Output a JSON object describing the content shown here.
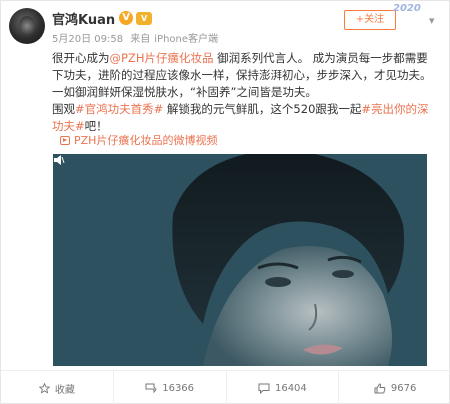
{
  "post": {
    "username": "官鸿Kuan",
    "verified_badge": "V",
    "level_badge": "V",
    "date": "5月20日 09:58",
    "source_prefix": "来自",
    "source": "iPhone客户端",
    "follow_label": "+关注",
    "anniversary_mark": "2020",
    "text": {
      "p1_a": "很开心成为",
      "p1_brand": "@PZH片仔癀化妆品",
      "p1_b": " 御润系列代言人。 成为演员每一步都需要下功夫，进阶的过程应该像水一样，保持澎湃初心，步步深入，才见功夫。一如御润鲜妍保湿悦肤水，“补固养”之间皆是功夫。",
      "p2_a": "围观",
      "p2_tag1": "#官鸿功夫首秀#",
      "p2_b": " 解锁我的元气鲜肌，这个520跟我一起",
      "p2_tag2": "#亮出你的深功夫#",
      "p2_c": "吧！"
    },
    "video_link": "PZH片仔癀化妆品的微博视频"
  },
  "actions": {
    "favorite_label": "收藏",
    "repost_count": "16366",
    "comment_count": "16404",
    "like_count": "9676"
  }
}
